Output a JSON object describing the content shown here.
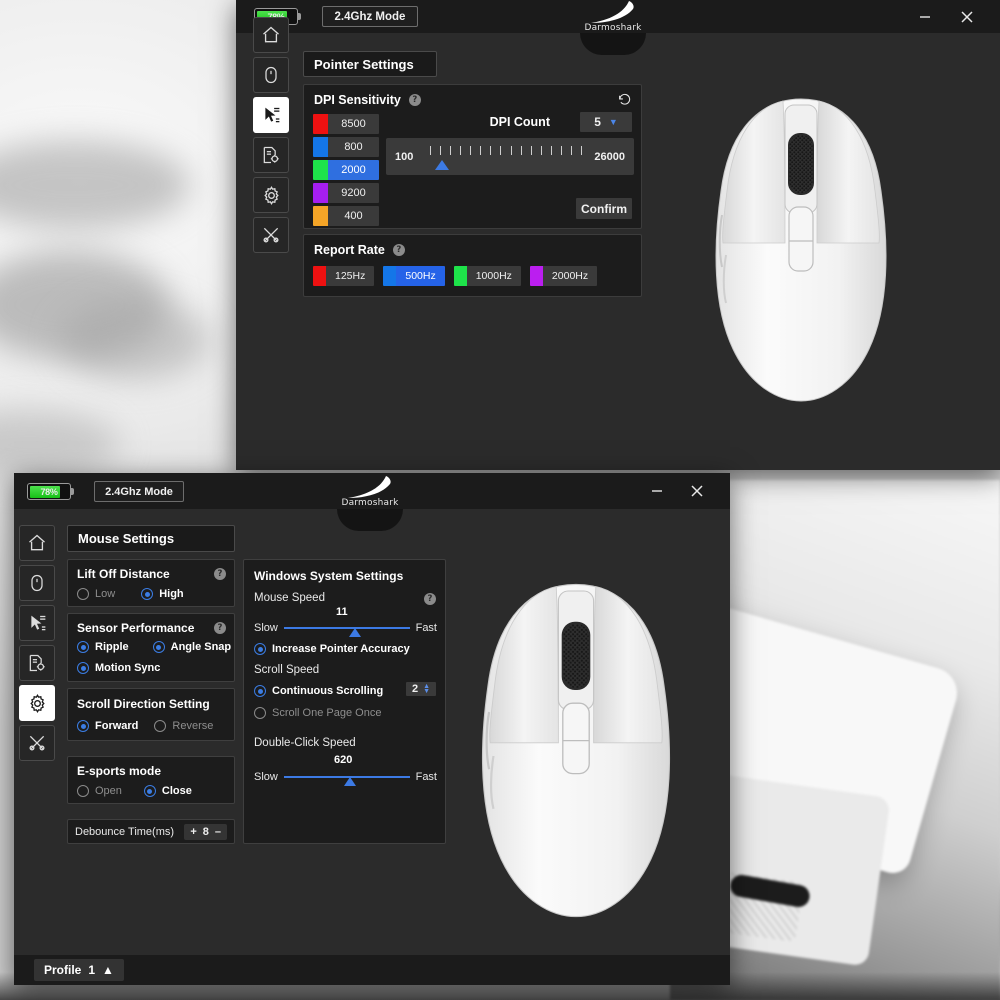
{
  "desktop": {
    "background_description": "blurred grayscale photo of white drone on snow"
  },
  "window_top": {
    "battery": {
      "percent_label": "78%",
      "percent": 78
    },
    "mode_button": "2.4Ghz Mode",
    "brand": "Darmoshark",
    "controls": {
      "minimize": "minimize-icon",
      "close": "close-icon"
    },
    "sidebar": [
      {
        "name": "home",
        "icon": "home-icon",
        "active": false
      },
      {
        "name": "mouse",
        "icon": "mouse-icon",
        "active": false
      },
      {
        "name": "pointer",
        "icon": "pointer-settings-icon",
        "active": true
      },
      {
        "name": "macro",
        "icon": "document-gear-icon",
        "active": false
      },
      {
        "name": "settings",
        "icon": "gear-icon",
        "active": false
      },
      {
        "name": "tools",
        "icon": "tools-icon",
        "active": false
      }
    ],
    "page_title": "Pointer Settings",
    "dpi_panel": {
      "title": "DPI Sensitivity",
      "help": "?",
      "reset_icon": "reset-icon",
      "dpi_count_label": "DPI Count",
      "dpi_count_value": "5",
      "stages": [
        {
          "color": "#ee1111",
          "value": "8500",
          "selected": false
        },
        {
          "color": "#1476e8",
          "value": "800",
          "selected": false
        },
        {
          "color": "#1ee34a",
          "value": "2000",
          "selected": true
        },
        {
          "color": "#a61ef0",
          "value": "9200",
          "selected": false
        },
        {
          "color": "#f5a527",
          "value": "400",
          "selected": false
        }
      ],
      "slider": {
        "min_label": "100",
        "max_label": "26000",
        "ticks": 16,
        "thumb_percent": 8
      },
      "confirm_label": "Confirm"
    },
    "report_rate_panel": {
      "title": "Report Rate",
      "help": "?",
      "options": [
        {
          "color": "#ee1111",
          "label": "125Hz",
          "selected": false
        },
        {
          "color": "#1476e8",
          "label": "500Hz",
          "selected": true
        },
        {
          "color": "#1ee34a",
          "label": "1000Hz",
          "selected": false
        },
        {
          "color": "#bb1ef0",
          "label": "2000Hz",
          "selected": false
        }
      ]
    }
  },
  "window_bottom": {
    "battery": {
      "percent_label": "78%",
      "percent": 78
    },
    "mode_button": "2.4Ghz Mode",
    "brand": "Darmoshark",
    "controls": {
      "minimize": "minimize-icon",
      "close": "close-icon"
    },
    "sidebar": [
      {
        "name": "home",
        "icon": "home-icon",
        "active": false
      },
      {
        "name": "mouse",
        "icon": "mouse-icon",
        "active": false
      },
      {
        "name": "pointer",
        "icon": "pointer-settings-icon",
        "active": false
      },
      {
        "name": "macro",
        "icon": "document-gear-icon",
        "active": false
      },
      {
        "name": "settings",
        "icon": "gear-icon",
        "active": true
      },
      {
        "name": "tools",
        "icon": "tools-icon",
        "active": false
      }
    ],
    "page_title": "Mouse Settings",
    "lift_off": {
      "title": "Lift Off Distance",
      "help": "?",
      "options": [
        {
          "label": "Low",
          "selected": false
        },
        {
          "label": "High",
          "selected": true
        }
      ]
    },
    "sensor": {
      "title": "Sensor Performance",
      "help": "?",
      "options": [
        {
          "label": "Ripple",
          "selected": true
        },
        {
          "label": "Angle Snap",
          "selected": true
        },
        {
          "label": "Motion Sync",
          "selected": true
        }
      ]
    },
    "scroll_dir": {
      "title": "Scroll Direction Setting",
      "options": [
        {
          "label": "Forward",
          "selected": true
        },
        {
          "label": "Reverse",
          "selected": false
        }
      ]
    },
    "esports": {
      "title": "E-sports mode",
      "options": [
        {
          "label": "Open",
          "selected": false
        },
        {
          "label": "Close",
          "selected": true
        }
      ]
    },
    "debounce": {
      "label": "Debounce Time(ms)",
      "plus": "+",
      "value": "8",
      "minus": "–"
    },
    "windows_settings": {
      "title": "Windows System Settings",
      "mouse_speed": {
        "label": "Mouse Speed",
        "help": "?",
        "value": "11",
        "min_label": "Slow",
        "max_label": "Fast",
        "thumb_percent": 52
      },
      "pointer_accuracy": {
        "label": "Increase Pointer Accuracy",
        "selected": true
      },
      "scroll_speed": {
        "label": "Scroll Speed",
        "options": [
          {
            "label": "Continuous Scrolling",
            "selected": true
          },
          {
            "label": "Scroll One Page Once",
            "selected": false
          }
        ],
        "lines_value": "2"
      },
      "double_click": {
        "label": "Double-Click Speed",
        "value": "620",
        "min_label": "Slow",
        "max_label": "Fast",
        "thumb_percent": 48
      }
    },
    "profile": {
      "label": "Profile",
      "number": "1",
      "caret": "▲"
    }
  }
}
